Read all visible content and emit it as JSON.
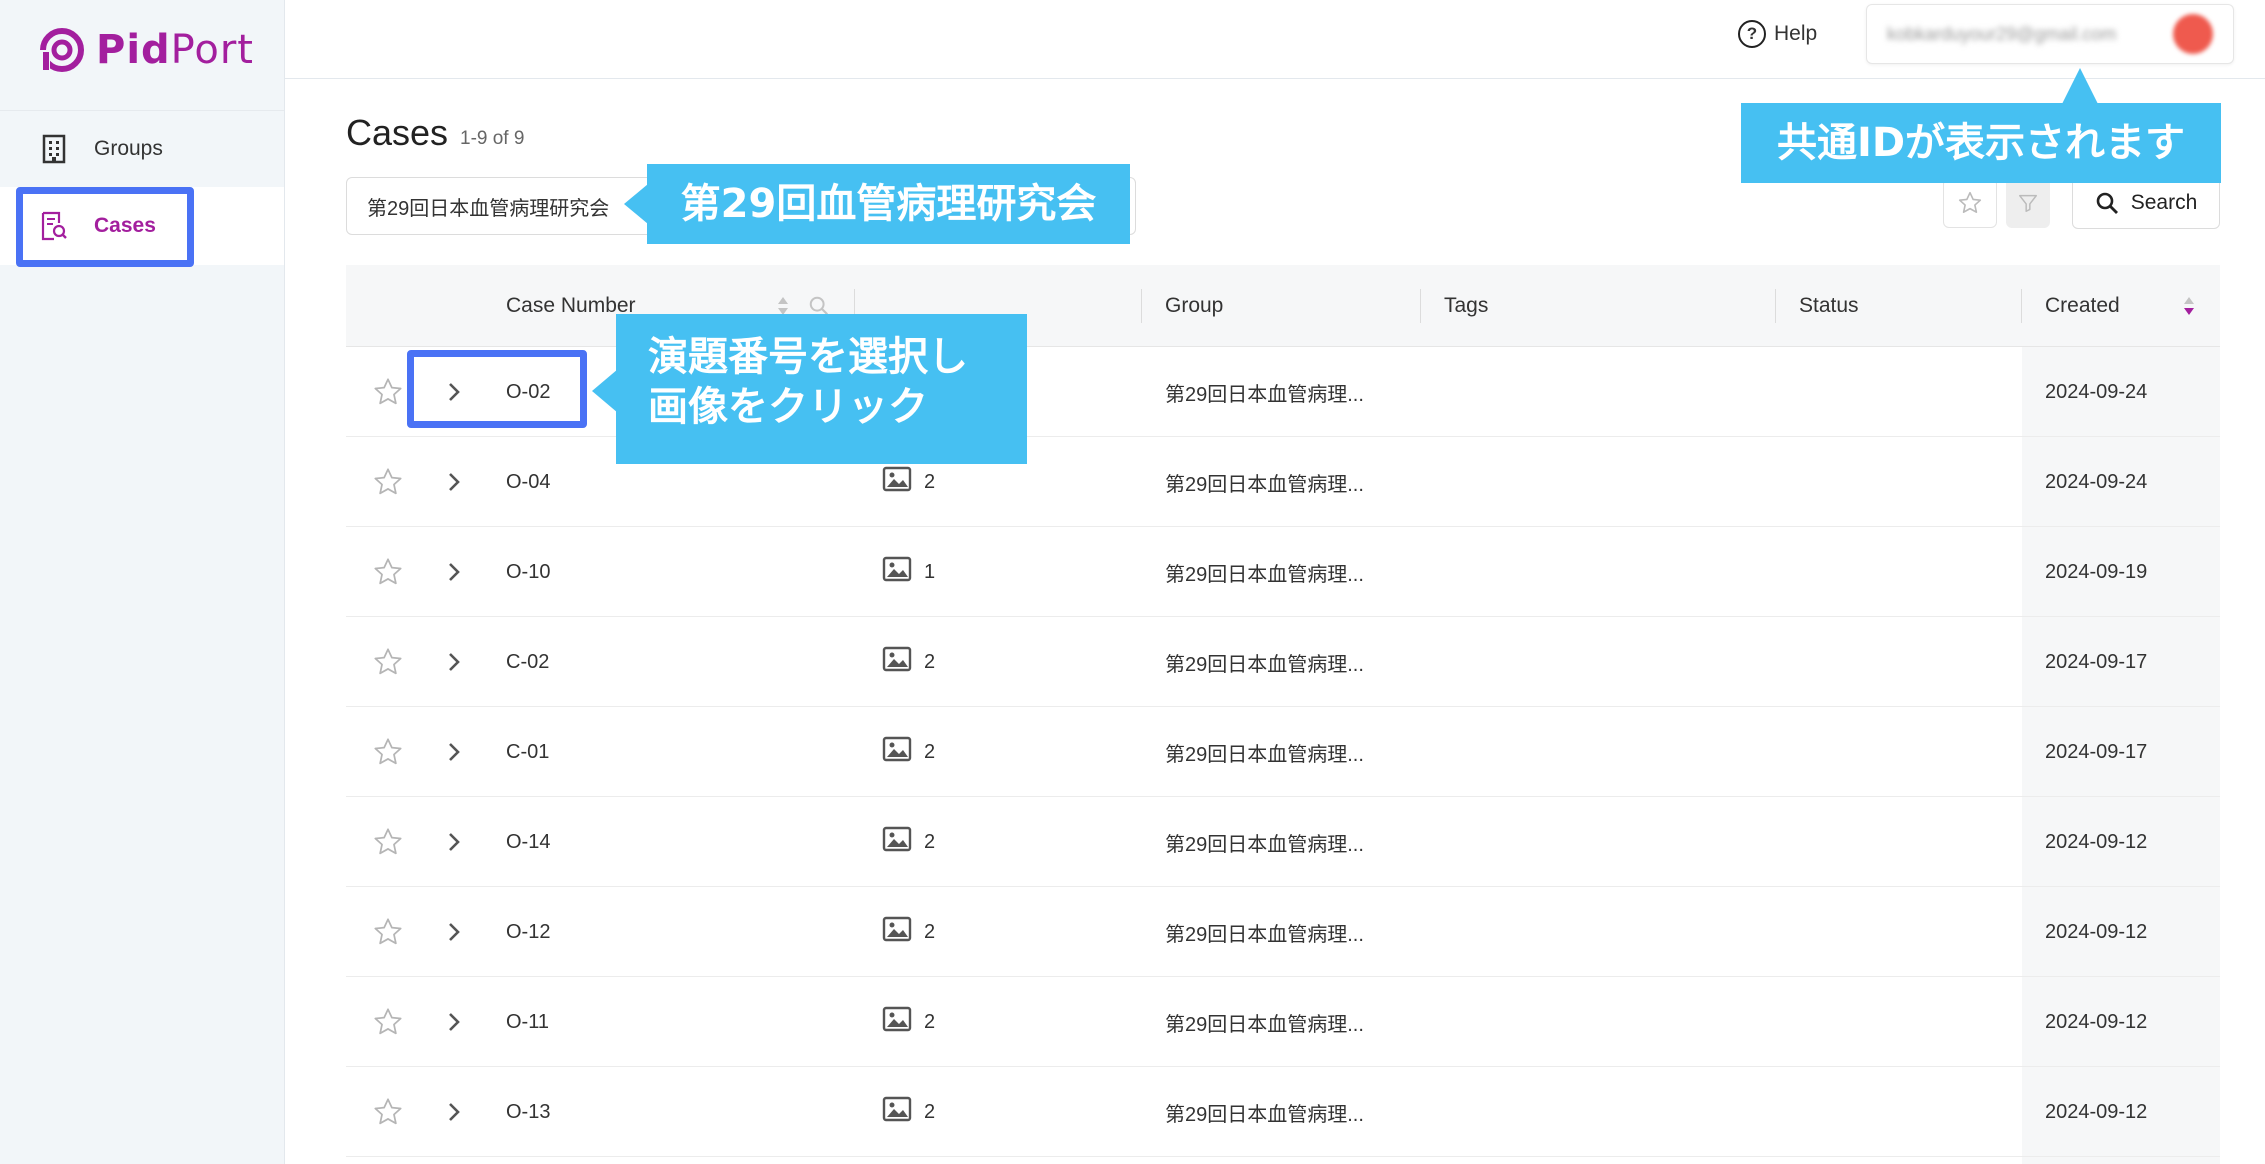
{
  "app": {
    "logo_pid": "Pid",
    "logo_port": "Port",
    "brand_color": "#a31f9e"
  },
  "sidebar": {
    "items": [
      {
        "label": "Groups",
        "icon": "building-icon"
      },
      {
        "label": "Cases",
        "icon": "case-search-icon",
        "active": true
      }
    ]
  },
  "header": {
    "help_label": "Help",
    "account_email": "kobkarduyour29@gmail.com"
  },
  "page": {
    "title": "Cases",
    "count": "1-9 of 9"
  },
  "filter": {
    "value": "第29回日本血管病理研究会"
  },
  "toolbar": {
    "search_label": "Search"
  },
  "table": {
    "headers": {
      "case_number": "Case Number",
      "group": "Group",
      "tags": "Tags",
      "status": "Status",
      "created": "Created"
    },
    "rows": [
      {
        "case": "O-02",
        "images": "",
        "group": "第29回日本血管病理...",
        "created": "2024-09-24"
      },
      {
        "case": "O-04",
        "images": "2",
        "group": "第29回日本血管病理...",
        "created": "2024-09-24"
      },
      {
        "case": "O-10",
        "images": "1",
        "group": "第29回日本血管病理...",
        "created": "2024-09-19"
      },
      {
        "case": "C-02",
        "images": "2",
        "group": "第29回日本血管病理...",
        "created": "2024-09-17"
      },
      {
        "case": "C-01",
        "images": "2",
        "group": "第29回日本血管病理...",
        "created": "2024-09-17"
      },
      {
        "case": "O-14",
        "images": "2",
        "group": "第29回日本血管病理...",
        "created": "2024-09-12"
      },
      {
        "case": "O-12",
        "images": "2",
        "group": "第29回日本血管病理...",
        "created": "2024-09-12"
      },
      {
        "case": "O-11",
        "images": "2",
        "group": "第29回日本血管病理...",
        "created": "2024-09-12"
      },
      {
        "case": "O-13",
        "images": "2",
        "group": "第29回日本血管病理...",
        "created": "2024-09-12"
      }
    ]
  },
  "annotations": {
    "id_note": "共通IDが表示されます",
    "group_note": "第29回血管病理研究会",
    "select_note_line1": "演題番号を選択し",
    "select_note_line2": "画像をクリック",
    "callout_color": "#46c0f2",
    "highlight_color": "#4a72f5"
  }
}
